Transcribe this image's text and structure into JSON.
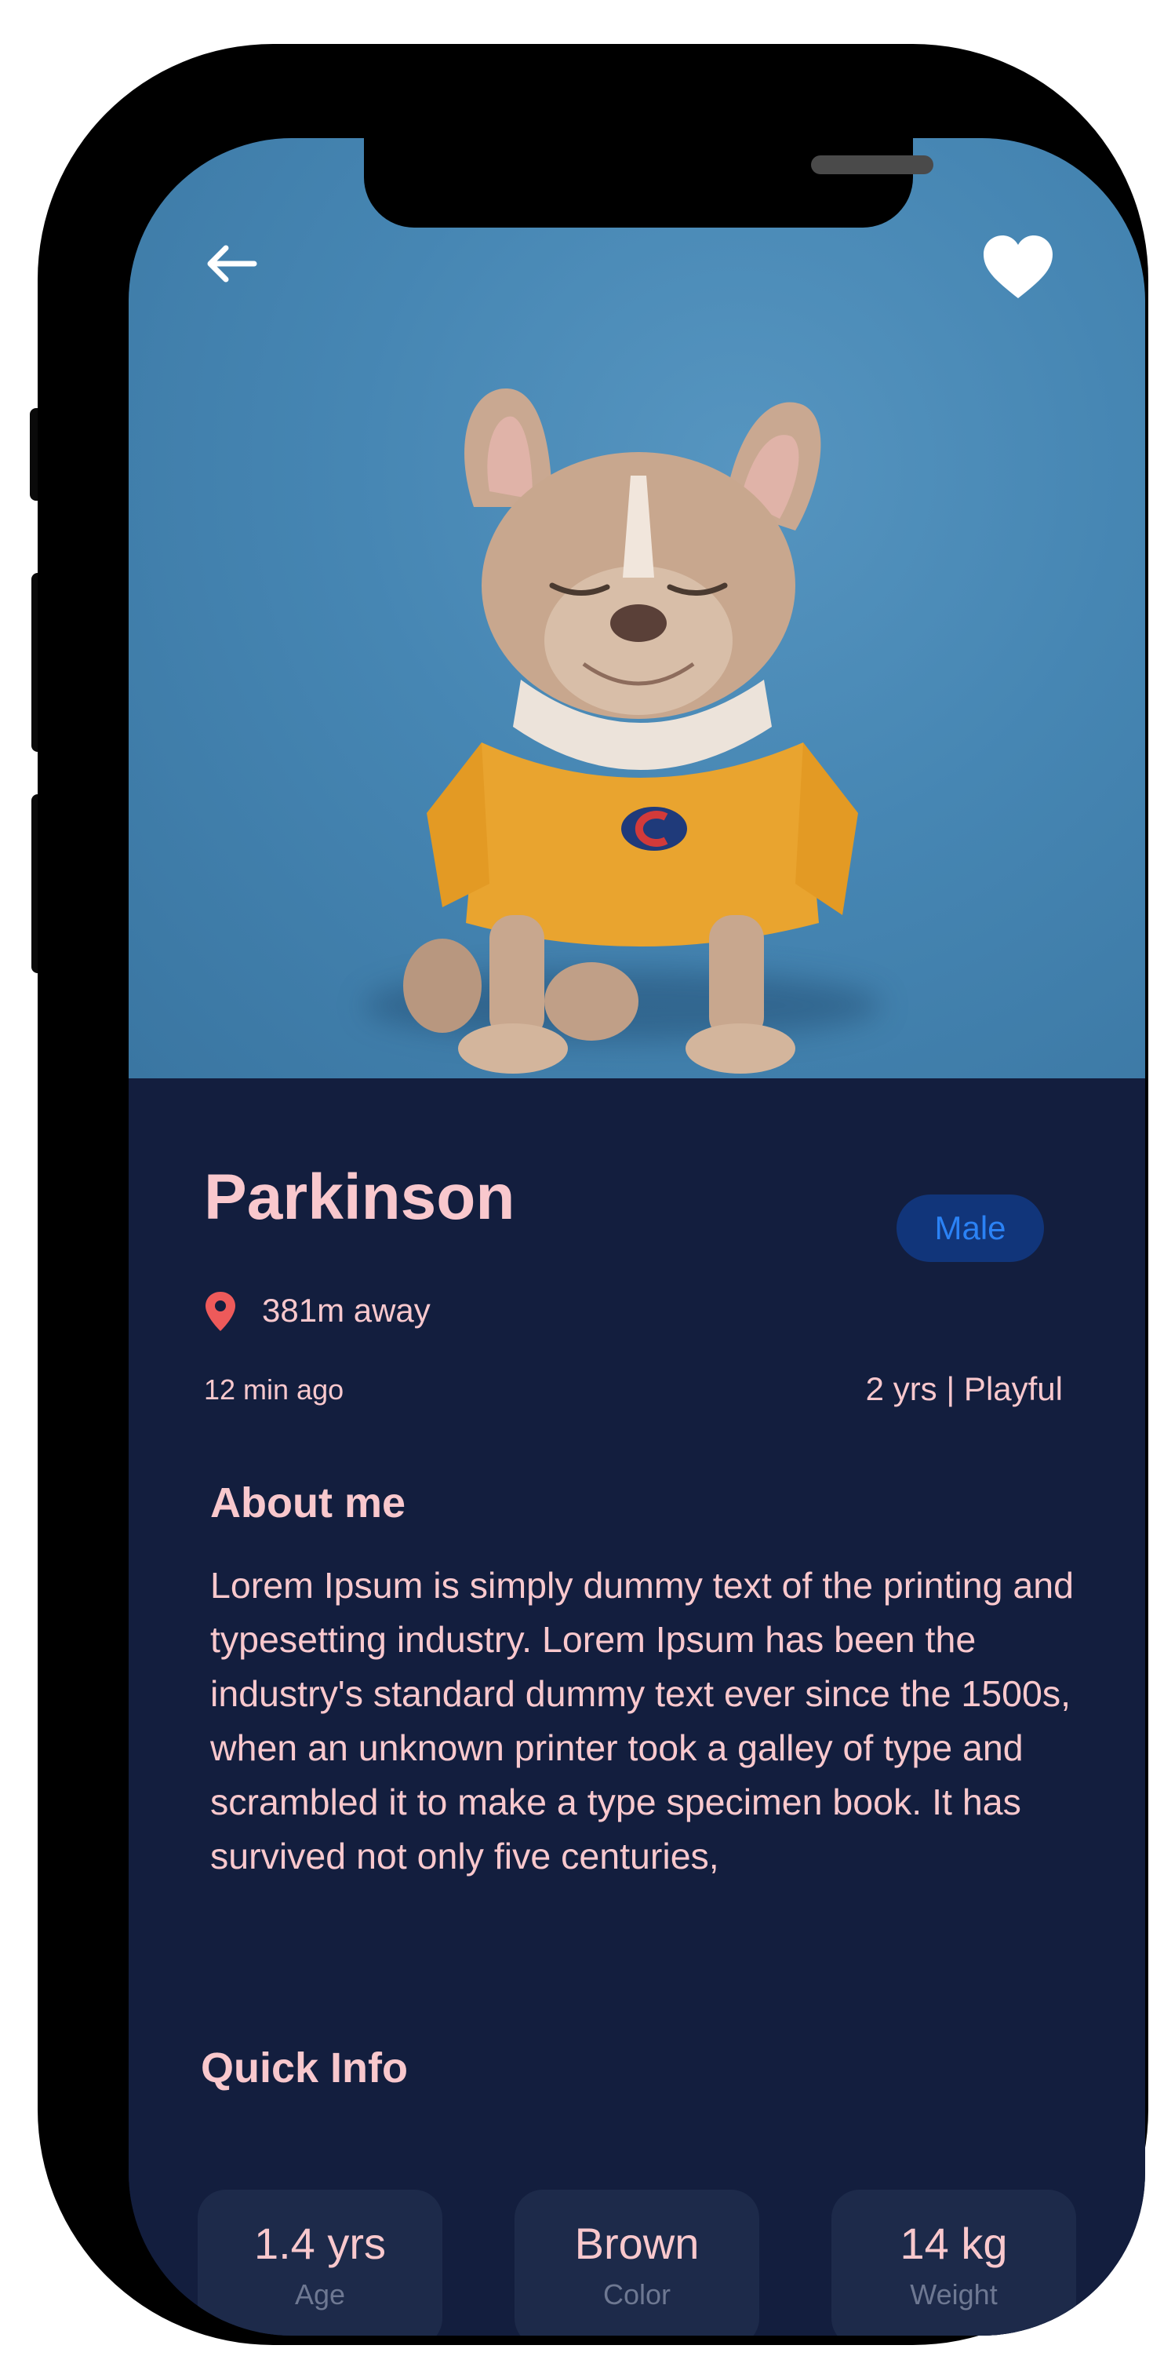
{
  "pet": {
    "name": "Parkinson",
    "gender": "Male",
    "distance": "381m away",
    "posted": "12 min ago",
    "traits": "2 yrs | Playful"
  },
  "about": {
    "title": "About me",
    "text": "Lorem Ipsum is simply dummy text of the printing and typesetting industry. Lorem Ipsum has been the industry's standard dummy text ever since the 1500s, when an unknown printer took a galley of type and scrambled it to make a type specimen book. It has survived not only five centuries,"
  },
  "quick_info": {
    "title": "Quick Info",
    "cards": [
      {
        "value": "1.4 yrs",
        "label": "Age"
      },
      {
        "value": "Brown",
        "label": "Color"
      },
      {
        "value": "14 kg",
        "label": "Weight"
      }
    ]
  },
  "icons": {
    "back": "back-arrow-icon",
    "favorite": "heart-icon",
    "location": "location-pin-icon"
  },
  "colors": {
    "background": "#131e3e",
    "text_accent": "#f9c8cd",
    "hero_blue": "#4686b3",
    "badge_bg": "#11357a",
    "badge_text": "#2b82f5",
    "pin_red": "#ee5a5a",
    "card_bg": "#1d2a4a"
  }
}
